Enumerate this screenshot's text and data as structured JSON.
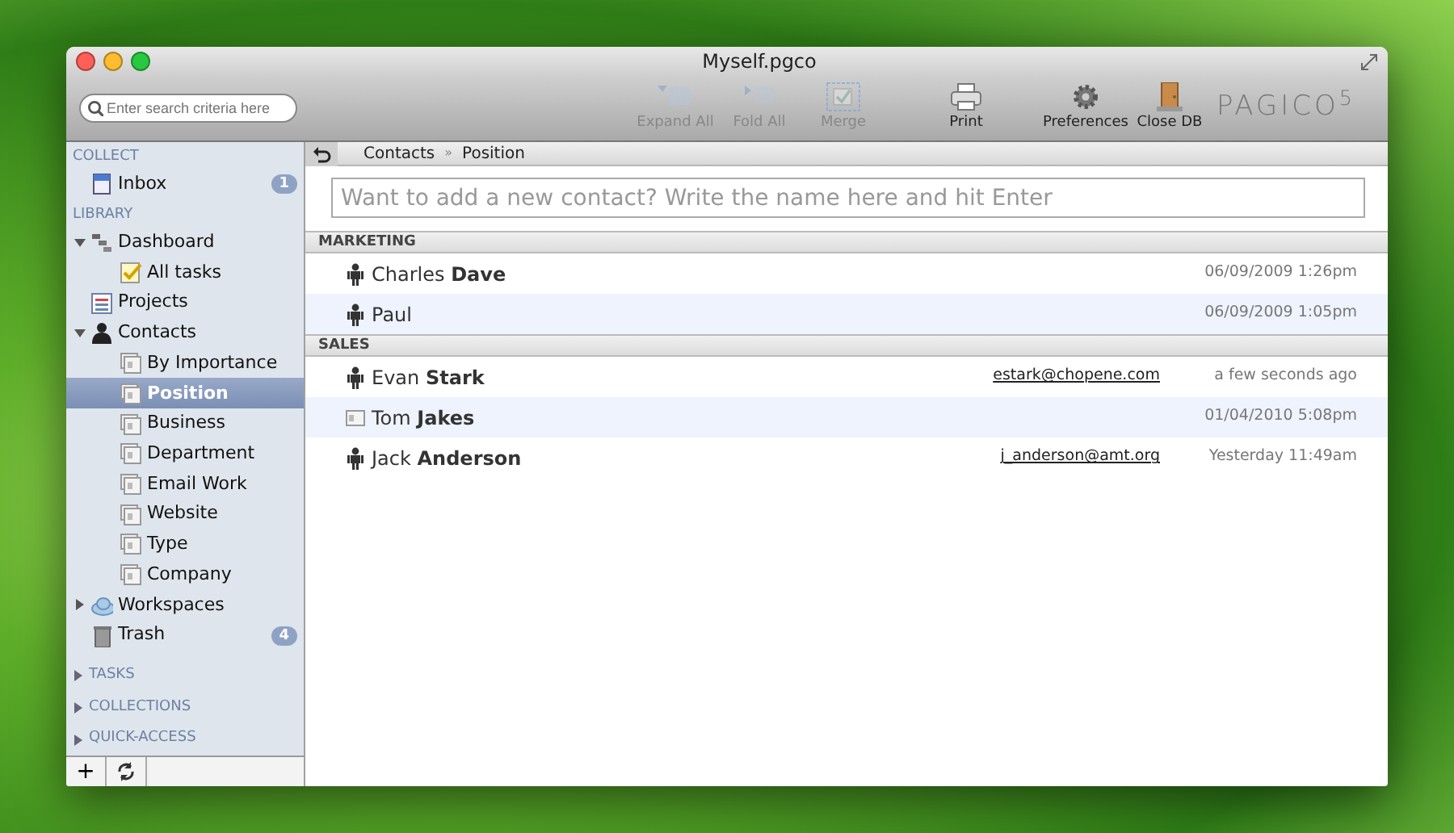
{
  "window": {
    "title": "Myself.pgco"
  },
  "search": {
    "placeholder": "Enter search criteria here"
  },
  "toolbar": {
    "buttons": [
      {
        "label": "Expand All",
        "kind": "expand",
        "disabled": true
      },
      {
        "label": "Fold All",
        "kind": "fold",
        "disabled": true
      },
      {
        "label": "Merge",
        "kind": "merge",
        "disabled": true
      },
      {
        "label": "Print",
        "kind": "print",
        "disabled": false
      },
      {
        "label": "Preferences",
        "kind": "gear",
        "disabled": false
      },
      {
        "label": "Close DB",
        "kind": "door",
        "disabled": false
      }
    ],
    "logo": "PAGICO$^{5}$"
  },
  "sidebar": {
    "sections": [
      {
        "label": "COLLECT",
        "items": [
          {
            "label": "Inbox",
            "kind": "inbox",
            "selected": false,
            "badge": "1"
          }
        ]
      },
      {
        "label": "LIBRARY",
        "items": [
          {
            "label": "Dashboard",
            "kind": "dashboard",
            "selected": false,
            "expanded": true,
            "children": [
              {
                "label": "All tasks",
                "kind": "tasks",
                "selected": false
              }
            ]
          },
          {
            "label": "Projects",
            "kind": "projects",
            "selected": false
          },
          {
            "label": "Contacts",
            "kind": "person",
            "selected": false,
            "expanded": true,
            "children": [
              {
                "label": "By Importance",
                "kind": "view",
                "selected": false
              },
              {
                "label": "Position",
                "kind": "view",
                "selected": true
              },
              {
                "label": "Business",
                "kind": "view",
                "selected": false
              },
              {
                "label": "Department",
                "kind": "view",
                "selected": false
              },
              {
                "label": "Email Work",
                "kind": "view",
                "selected": false
              },
              {
                "label": "Website",
                "kind": "view",
                "selected": false
              },
              {
                "label": "Type",
                "kind": "view",
                "selected": false
              },
              {
                "label": "Company",
                "kind": "view",
                "selected": false
              }
            ]
          },
          {
            "label": "Workspaces",
            "kind": "cloud",
            "selected": false,
            "expanded": false
          },
          {
            "label": "Trash",
            "kind": "trash",
            "selected": false,
            "badge": "4"
          }
        ]
      }
    ],
    "collapsed": [
      {
        "label": "TASKS",
        "expanded": false
      },
      {
        "label": "COLLECTIONS",
        "expanded": false
      },
      {
        "label": "QUICK-ACCESS",
        "expanded": false
      }
    ],
    "footer_buttons": [
      {
        "kind": "add",
        "label": "+"
      },
      {
        "kind": "refresh"
      }
    ]
  },
  "breadcrumb": {
    "items": [
      "Contacts",
      "Position"
    ],
    "separator": "»"
  },
  "quick_add": {
    "placeholder": "Want to add a new contact? Write the name here and hit Enter"
  },
  "groups": [
    {
      "title": "MARKETING",
      "contacts": [
        {
          "name": "Charles **Dave**",
          "kind": "person",
          "time": "06/09/2009 1:26pm"
        },
        {
          "name": "Paul",
          "kind": "person",
          "time": "06/09/2009 1:05pm"
        }
      ]
    },
    {
      "title": "SALES",
      "contacts": [
        {
          "name": "Evan **Stark**",
          "kind": "person",
          "email": "estark@chopene.com",
          "time": "a few seconds ago"
        },
        {
          "name": "Tom **Jakes**",
          "kind": "card",
          "time": "01/04/2010 5:08pm"
        },
        {
          "name": "Jack **Anderson**",
          "kind": "person",
          "email": "j_anderson@amt.org",
          "time": "Yesterday 11:49am"
        }
      ]
    }
  ]
}
